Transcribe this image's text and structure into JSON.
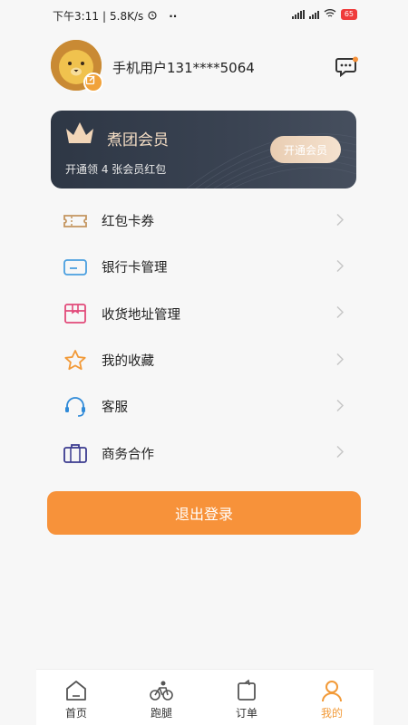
{
  "status_bar": {
    "time": "下午3:11",
    "separator": "|",
    "net_speed": "5.8K/s",
    "dots": "··",
    "battery": "65"
  },
  "profile": {
    "username": "手机用户131****5064"
  },
  "vip": {
    "title": "煮团会员",
    "subtitle": "开通领 4 张会员红包",
    "button": "开通会员"
  },
  "menu": [
    {
      "label": "红包卡券",
      "icon": "coupon-icon"
    },
    {
      "label": "银行卡管理",
      "icon": "bank-card-icon"
    },
    {
      "label": "收货地址管理",
      "icon": "address-box-icon"
    },
    {
      "label": "我的收藏",
      "icon": "star-icon"
    },
    {
      "label": "客服",
      "icon": "headset-icon"
    },
    {
      "label": "商务合作",
      "icon": "briefcase-icon"
    }
  ],
  "logout": {
    "label": "退出登录"
  },
  "tabbar": [
    {
      "label": "首页",
      "icon": "home-icon",
      "active": false
    },
    {
      "label": "跑腿",
      "icon": "bicycle-icon",
      "active": false
    },
    {
      "label": "订单",
      "icon": "order-icon",
      "active": false
    },
    {
      "label": "我的",
      "icon": "user-icon",
      "active": true
    }
  ],
  "colors": {
    "accent": "#f7923a",
    "active_tab": "#f29a38",
    "vip_bg": "#3a4352",
    "vip_gold": "#f3dcc3"
  }
}
